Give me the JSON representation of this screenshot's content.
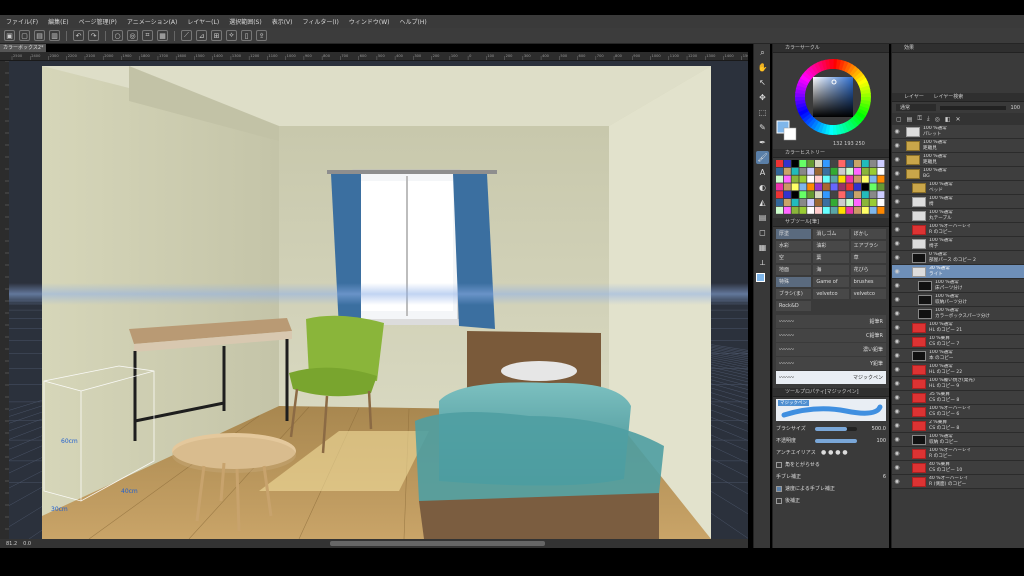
{
  "menu": [
    "ファイル(F)",
    "編集(E)",
    "ページ管理(P)",
    "アニメーション(A)",
    "レイヤー(L)",
    "選択範囲(S)",
    "表示(V)",
    "フィルター(I)",
    "ウィンドウ(W)",
    "ヘルプ(H)"
  ],
  "document_tab": "カラーボックス2*",
  "ruler_ticks": [
    "2500",
    "2400",
    "2300",
    "2200",
    "2100",
    "2000",
    "1900",
    "1800",
    "1700",
    "1600",
    "1500",
    "1400",
    "1300",
    "1200",
    "1100",
    "1000",
    "900",
    "800",
    "700",
    "600",
    "500",
    "400",
    "300",
    "200",
    "100",
    "0",
    "100",
    "200",
    "300",
    "400",
    "500",
    "600",
    "700",
    "800",
    "900",
    "1000",
    "1100",
    "1200",
    "1300",
    "1400",
    "1500"
  ],
  "canvas_annotations": [
    "60cm",
    "40cm",
    "30cm"
  ],
  "status": {
    "zoom": "81.2",
    "rotation": "0.0"
  },
  "color_circle": {
    "title": "カラーサークル",
    "hsv": "132  193  250",
    "main_color": "#7fb6ea",
    "sub_color": "#ffffff"
  },
  "color_history": {
    "title": "カラーヒストリー"
  },
  "subtool": {
    "title": "サブツール[筆]",
    "tabs": [
      "厚塗",
      "消しゴム",
      "ぼかし"
    ],
    "grid": [
      "水彩",
      "油彩",
      "エアブラシ",
      "空",
      "葉",
      "草",
      "地面",
      "海",
      "花びら",
      "特殊",
      "Game of",
      "brushes",
      "ブラシ(ま)",
      "velvetco",
      "velvetco",
      "Rock&D"
    ],
    "brushes": [
      {
        "label": "鉛筆R",
        "active": false
      },
      {
        "label": "C鉛筆R",
        "active": false
      },
      {
        "label": "濃い鉛筆",
        "active": false
      },
      {
        "label": "Y鉛筆",
        "active": false
      },
      {
        "label": "マジックペン",
        "active": true
      }
    ]
  },
  "tool_property": {
    "title": "ツールプロパティ[マジックペン]",
    "preview_label": "マジックペン",
    "brush_size_label": "ブラシサイズ",
    "brush_size_value": "500.0",
    "brush_size_fraction": 0.75,
    "opacity_label": "不透明度",
    "opacity_value": "100",
    "opacity_fraction": 1.0,
    "antialias_label": "アンチエイリアス",
    "round_corner_label": "角をとがらせる",
    "stabilization_label": "手ブレ補正",
    "stabilization_value": "6",
    "speed_stabilization_label": "速度による手ブレ補正",
    "post_correction_label": "後補正"
  },
  "effects": {
    "title": "効果"
  },
  "layers_panel": {
    "title": "レイヤー",
    "tab2": "レイヤー検索",
    "blend_mode": "通常",
    "opacity": "100",
    "layers": [
      {
        "mode": "100 %通常",
        "name": "パレット",
        "type": "white",
        "indent": 0,
        "selected": false
      },
      {
        "mode": "100 %通常",
        "name": "距離見",
        "type": "folder",
        "indent": 0,
        "selected": false
      },
      {
        "mode": "100 %通常",
        "name": "距離見",
        "type": "folder",
        "indent": 0,
        "selected": false
      },
      {
        "mode": "100 %通常",
        "name": "BG",
        "type": "folder",
        "indent": 0,
        "selected": false
      },
      {
        "mode": "100 %通常",
        "name": "ベッド",
        "type": "folder",
        "indent": 1,
        "selected": false
      },
      {
        "mode": "100 %通常",
        "name": "椅",
        "type": "white",
        "indent": 1,
        "selected": false
      },
      {
        "mode": "100 %通常",
        "name": "丸テーブル",
        "type": "white",
        "indent": 1,
        "selected": false
      },
      {
        "mode": "100 %オーバーレイ",
        "name": "R のコピー",
        "type": "red",
        "indent": 1,
        "selected": false
      },
      {
        "mode": "100 %通常",
        "name": "椅子",
        "type": "white",
        "indent": 1,
        "selected": false
      },
      {
        "mode": "0 %通常",
        "name": "部屋パース のコピー 2",
        "type": "dark",
        "indent": 1,
        "selected": false
      },
      {
        "mode": "30 %通常",
        "name": "ライト",
        "type": "white",
        "indent": 1,
        "selected": true
      },
      {
        "mode": "100 %通常",
        "name": "床パーツ分け",
        "type": "dark",
        "indent": 2,
        "selected": false
      },
      {
        "mode": "100 %通常",
        "name": "収納パーツ分け",
        "type": "dark",
        "indent": 2,
        "selected": false
      },
      {
        "mode": "100 %通常",
        "name": "カラーボックスパーツ分け",
        "type": "dark",
        "indent": 2,
        "selected": false
      },
      {
        "mode": "100 %通常",
        "name": "HL のコピー 21",
        "type": "red",
        "indent": 1,
        "selected": false
      },
      {
        "mode": "10 %乗算",
        "name": "CS のコピー 7",
        "type": "red",
        "indent": 1,
        "selected": false
      },
      {
        "mode": "100 %通常",
        "name": "本 のコピー",
        "type": "dark",
        "indent": 1,
        "selected": false
      },
      {
        "mode": "100 %通常",
        "name": "HL のコピー 22",
        "type": "red",
        "indent": 1,
        "selected": false
      },
      {
        "mode": "100 %覆い焼き(発光)",
        "name": "HL のコピー 9",
        "type": "red",
        "indent": 1,
        "selected": false
      },
      {
        "mode": "35 %乗算",
        "name": "CS のコピー 8",
        "type": "red",
        "indent": 1,
        "selected": false
      },
      {
        "mode": "100 %オーバーレイ",
        "name": "CS のコピー 6",
        "type": "red",
        "indent": 1,
        "selected": false
      },
      {
        "mode": "2 %乗算",
        "name": "CS のコピー 8",
        "type": "red",
        "indent": 1,
        "selected": false
      },
      {
        "mode": "100 %通常",
        "name": "収納 のコピー",
        "type": "dark",
        "indent": 1,
        "selected": false
      },
      {
        "mode": "100 %オーバーレイ",
        "name": "R のコピー",
        "type": "red",
        "indent": 1,
        "selected": false
      },
      {
        "mode": "40 %乗算",
        "name": "CS のコピー 10",
        "type": "red",
        "indent": 1,
        "selected": false
      },
      {
        "mode": "40 %オーバーレイ",
        "name": "R (側面) のコピー",
        "type": "red",
        "indent": 1,
        "selected": false
      }
    ]
  },
  "colors": {
    "accent": "#6e8fb8",
    "curtain": "#3b6fa0",
    "chair": "#8ab53a",
    "bedding": "#5aa6a6"
  }
}
